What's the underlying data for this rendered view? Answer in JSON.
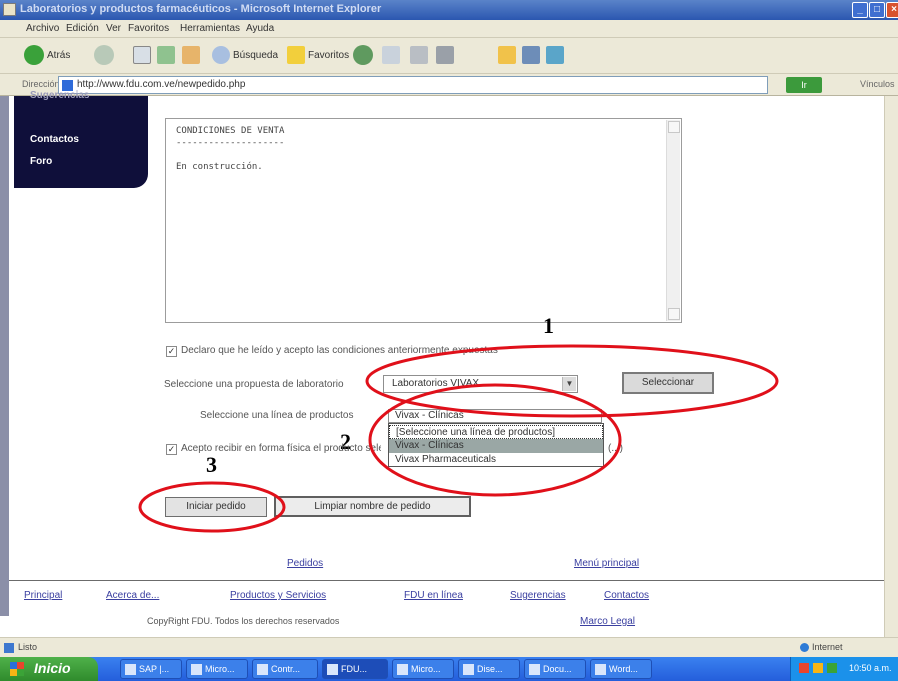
{
  "window": {
    "title": "Laboratorios y productos farmacéuticos - Microsoft Internet Explorer",
    "min_label": "_",
    "max_label": "□",
    "close_label": "×"
  },
  "menu": [
    "Archivo",
    "Edición",
    "Ver",
    "Favoritos",
    "Herramientas",
    "Ayuda"
  ],
  "toolbar": {
    "back_label": "Atrás",
    "search_label": "Búsqueda",
    "favorites_label": "Favoritos"
  },
  "address": {
    "label": "Dirección",
    "url": "http://www.fdu.com.ve/newpedido.php",
    "go_label": "Ir",
    "links_label": "Vínculos"
  },
  "sidenav": {
    "items": [
      "Sugerencias",
      "Contactos",
      "Foro"
    ]
  },
  "terms": {
    "text": "CONDICIONES DE VENTA\n--------------------\n\nEn construcción."
  },
  "form": {
    "checkbox1_label": "Declaro que he leído y acepto las condiciones anteriormente expuestas",
    "lab_label": "Seleccione una propuesta de laboratorio",
    "lab_value": "Laboratorios VIVAX",
    "lab_arrow": "▼",
    "select_button": "Seleccionar",
    "line_label": "Seleccione una línea de productos",
    "line_value": "Vivax - Clínicas",
    "line_options": [
      "[Seleccione una línea de productos]",
      "Vivax - Clínicas",
      "Vivax Pharmaceuticals"
    ],
    "checkbox2_label": "Acepto recibir en forma física el producto seleccionado (contra entrega y pago)",
    "start_button": "Iniciar pedido",
    "clear_button": "Limpiar nombre de pedido",
    "checkmark": "✓"
  },
  "annotations": [
    "1",
    "2",
    "3"
  ],
  "bottom_links": {
    "pedidos": "Pedidos",
    "menu_principal": "Menú principal"
  },
  "footer": {
    "links": [
      "Principal",
      "Acerca de...",
      "Productos y Servicios",
      "FDU en línea",
      "Sugerencias",
      "Contactos"
    ],
    "copyright": "CopyRight FDU. Todos los derechos reservados",
    "legal": "Marco Legal"
  },
  "status": {
    "text": "Listo",
    "zone": "Internet"
  },
  "taskbar": {
    "start_label": "Inicio",
    "tasks": [
      "SAP |...",
      "Micro...",
      "Contr...",
      "FDU...",
      "Micro...",
      "Dise...",
      "Docu...",
      "Word..."
    ],
    "clock": "10:50 a.m."
  },
  "colors": {
    "annotation": "#e0101a",
    "nav_bg": "#0f0f3a",
    "link": "#3a3fa0"
  }
}
